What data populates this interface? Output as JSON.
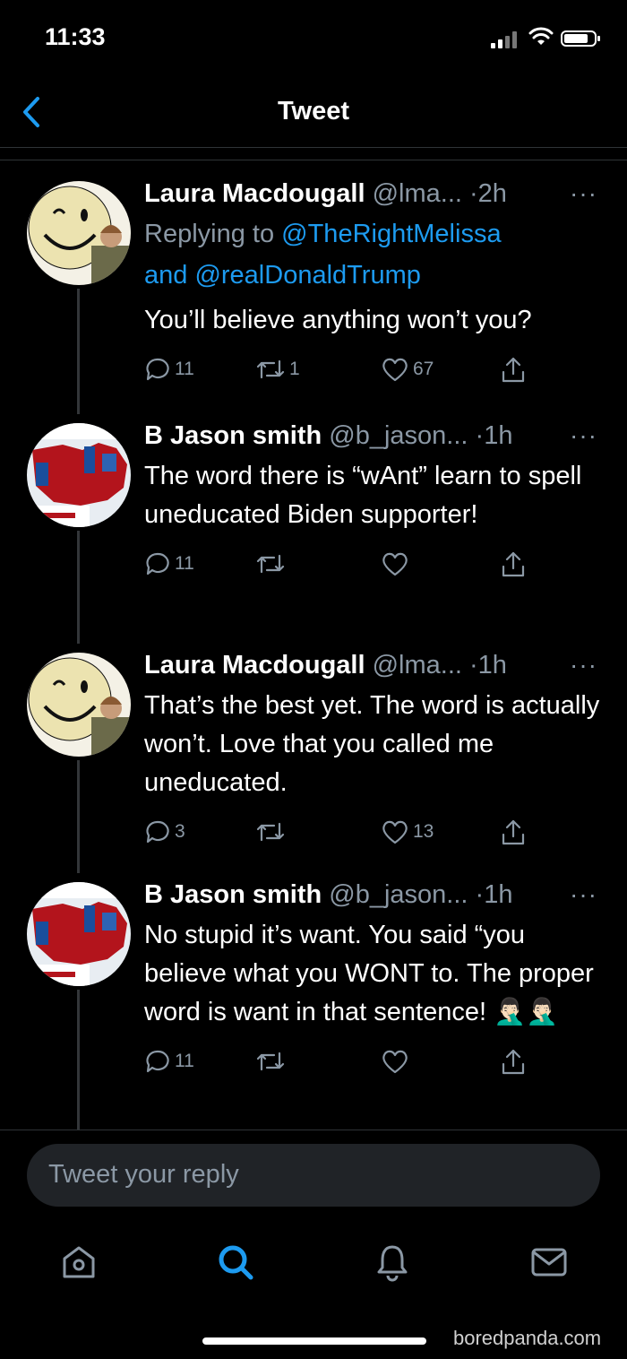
{
  "status_bar": {
    "time": "11:33"
  },
  "nav": {
    "title": "Tweet"
  },
  "tweets": [
    {
      "name": "Laura Macdougall",
      "handle": "@lma...",
      "time": "·2h",
      "replying_prefix": "Replying to",
      "replying_to_1": "@TheRightMelissa",
      "replying_and": "and",
      "replying_to_2": "@realDonaldTrump",
      "text": "You’ll believe anything won’t you?",
      "replies": "11",
      "retweets": "1",
      "likes": "67"
    },
    {
      "name": "B Jason smith",
      "handle": "@b_jason...",
      "time": "·1h",
      "text": "The word there is “wAnt” learn to spell uneducated Biden supporter!",
      "replies": "11",
      "retweets": "",
      "likes": ""
    },
    {
      "name": "Laura Macdougall",
      "handle": "@lma...",
      "time": "·1h",
      "text": "That’s the best yet. The word is actually won’t. Love that you called me uneducated.",
      "replies": "3",
      "retweets": "",
      "likes": "13"
    },
    {
      "name": "B Jason smith",
      "handle": "@b_jason...",
      "time": "·1h",
      "text": "No stupid it’s want. You said “you believe what you WONT to. The proper word is want in that sentence! 🤦🏻‍♂️🤦🏻‍♂️",
      "replies": "11",
      "retweets": "",
      "likes": ""
    }
  ],
  "composer": {
    "placeholder": "Tweet your reply"
  },
  "tabs": [
    {
      "icon": "home-icon"
    },
    {
      "icon": "search-icon"
    },
    {
      "icon": "bell-icon"
    },
    {
      "icon": "mail-icon"
    }
  ],
  "watermark": "boredpanda.com",
  "colors": {
    "background": "#000000",
    "accent": "#1d9bf0",
    "secondary_text": "#8b98a5"
  }
}
